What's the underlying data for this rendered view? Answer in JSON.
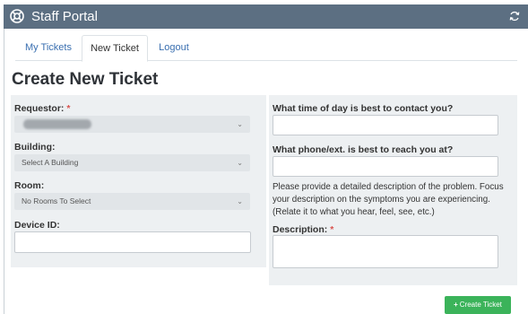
{
  "app": {
    "title": "Staff Portal",
    "logo_icon": "lifebuoy-icon",
    "refresh_icon": "refresh-icon"
  },
  "tabs": [
    {
      "label": "My Tickets",
      "active": false
    },
    {
      "label": "New Ticket",
      "active": true
    },
    {
      "label": "Logout",
      "active": false
    }
  ],
  "page": {
    "title": "Create New Ticket"
  },
  "form": {
    "requestor": {
      "label": "Requestor:",
      "required_mark": "*",
      "value": ""
    },
    "building": {
      "label": "Building:",
      "value": "Select A Building"
    },
    "room": {
      "label": "Room:",
      "value": "No Rooms To Select"
    },
    "device_id": {
      "label": "Device ID:",
      "value": ""
    },
    "contact_time": {
      "label": "What time of day is best to contact you?",
      "value": ""
    },
    "phone": {
      "label": "What phone/ext. is best to reach you at?",
      "value": ""
    },
    "help_text": "Please provide a detailed description of the problem. Focus your description on the symptoms you are experiencing. (Relate it to what you hear, feel, see, etc.)",
    "description": {
      "label": "Description:",
      "required_mark": "*",
      "value": ""
    }
  },
  "actions": {
    "create_label": "Create Ticket",
    "create_icon": "plus-icon"
  },
  "colors": {
    "titlebar": "#5c6f82",
    "link": "#3a6fb0",
    "panel": "#edf0f2",
    "required": "#d9534f",
    "button": "#3bb35a"
  }
}
